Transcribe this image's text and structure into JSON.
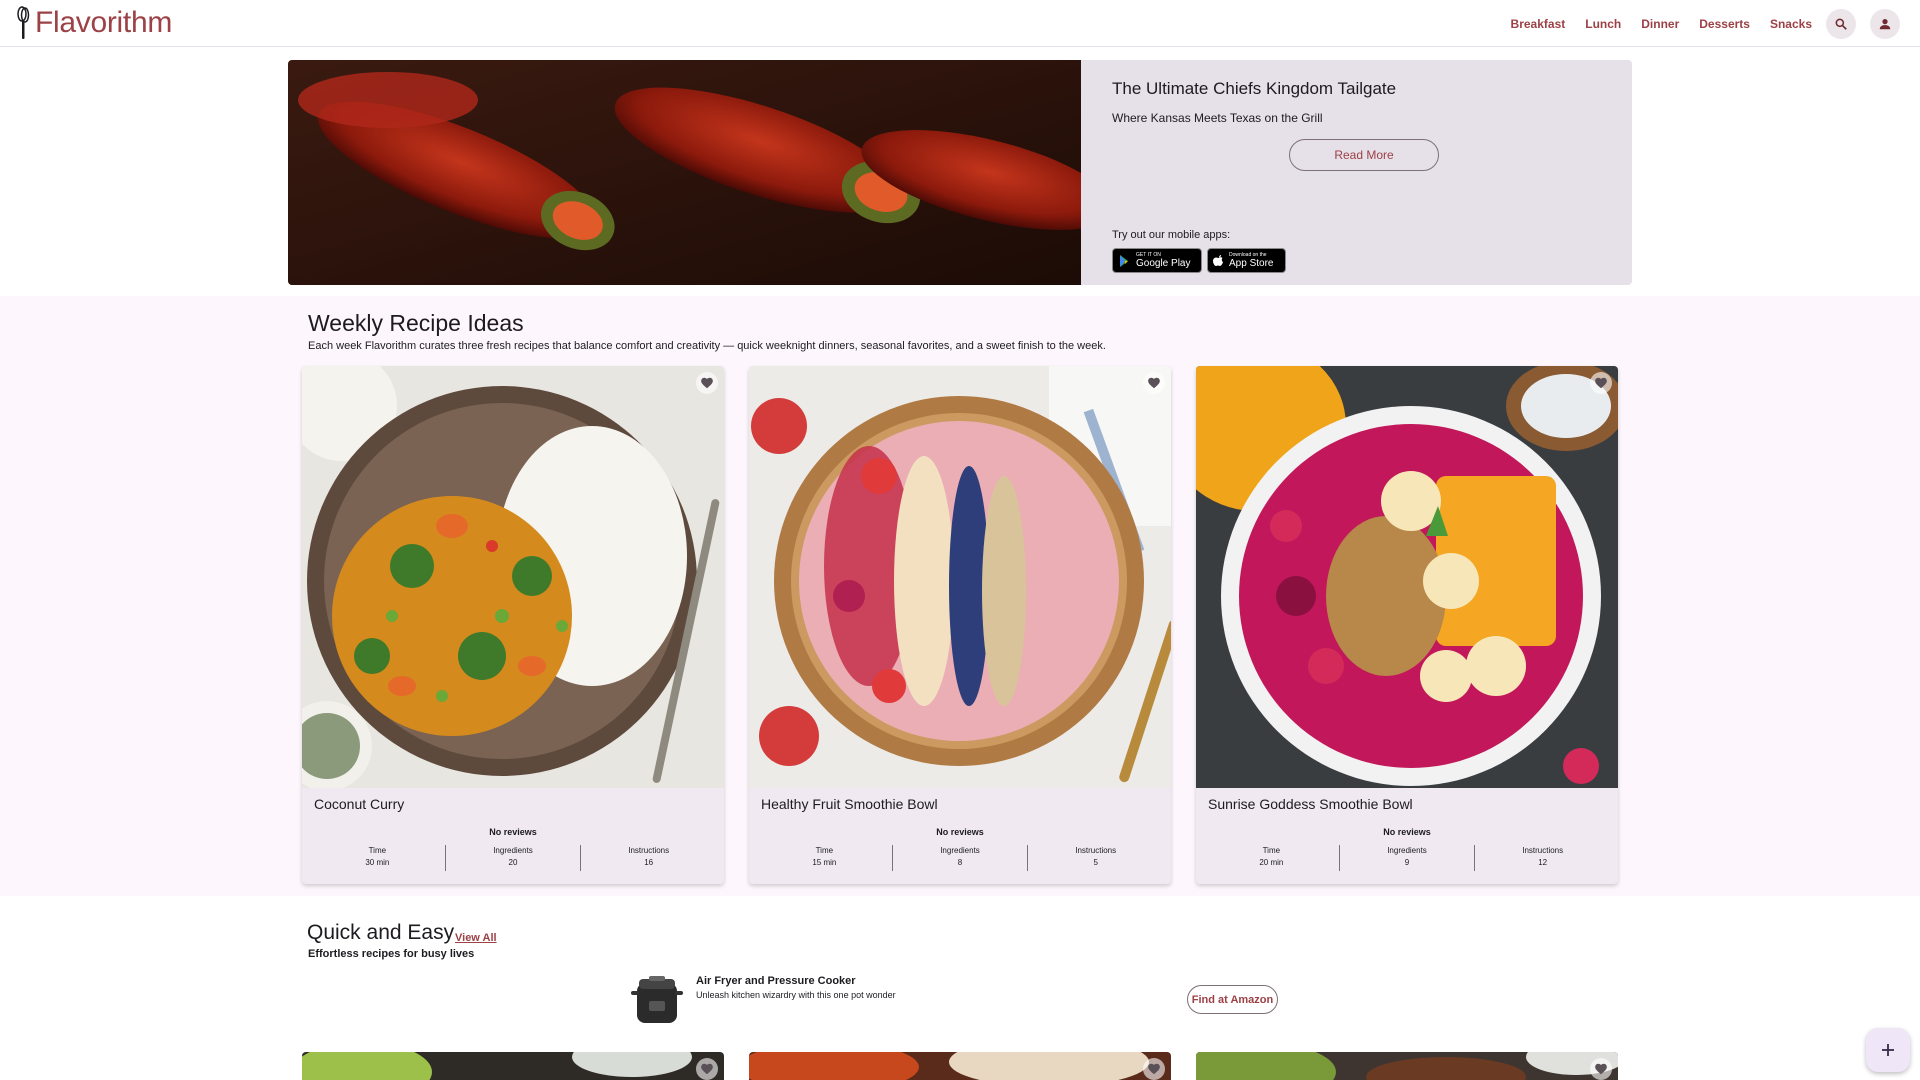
{
  "header": {
    "logo_text": "Flavorithm",
    "nav": [
      "Breakfast",
      "Lunch",
      "Dinner",
      "Desserts",
      "Snacks"
    ],
    "search_icon": "search-icon",
    "account_icon": "account-icon"
  },
  "hero": {
    "title": "The Ultimate Chiefs Kingdom Tailgate",
    "subtitle": "Where Kansas Meets Texas on the Grill",
    "read_more": "Read More",
    "apps_label": "Try out our mobile apps:",
    "google_play_small": "GET IT ON",
    "google_play_big": "Google Play",
    "app_store_small": "Download on the",
    "app_store_big": "App Store"
  },
  "weekly": {
    "title": "Weekly Recipe Ideas",
    "description": "Each week Flavorithm curates three fresh recipes that balance comfort and creativity — quick weeknight dinners, seasonal favorites, and a sweet finish to the week.",
    "cards": [
      {
        "name": "Coconut Curry",
        "reviews": "No reviews",
        "time_label": "Time",
        "time": "30 min",
        "ingredients_label": "Ingredients",
        "ingredients": "20",
        "instructions_label": "Instructions",
        "instructions": "16"
      },
      {
        "name": "Healthy Fruit Smoothie Bowl",
        "reviews": "No reviews",
        "time_label": "Time",
        "time": "15 min",
        "ingredients_label": "Ingredients",
        "ingredients": "8",
        "instructions_label": "Instructions",
        "instructions": "5"
      },
      {
        "name": "Sunrise Goddess Smoothie Bowl",
        "reviews": "No reviews",
        "time_label": "Time",
        "time": "20 min",
        "ingredients_label": "Ingredients",
        "ingredients": "9",
        "instructions_label": "Instructions",
        "instructions": "12"
      }
    ]
  },
  "quick": {
    "title": "Quick and Easy",
    "view_all": "View All",
    "subtitle": "Effortless recipes for busy lives",
    "promo_title": "Air Fryer and Pressure Cooker",
    "promo_subtitle": "Unleash kitchen wizardry with this one pot wonder",
    "promo_button": "Find at Amazon"
  },
  "fab": {
    "icon": "plus-icon"
  },
  "colors": {
    "brand": "#9c4146",
    "card_bg": "#f0e9f2",
    "hero_bg": "#e6e0e9",
    "section_bg": "#fdf7fd"
  }
}
